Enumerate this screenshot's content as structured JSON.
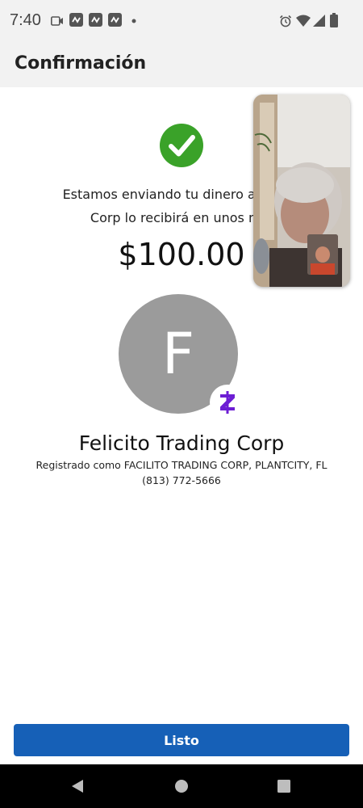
{
  "status_bar": {
    "time": "7:40",
    "left_icons": [
      "video-camera-icon",
      "app-notification-icon",
      "app-notification-icon",
      "app-notification-icon",
      "dot-icon"
    ],
    "right_icons": [
      "alarm-icon",
      "wifi-icon",
      "signal-icon",
      "battery-icon"
    ]
  },
  "header": {
    "title": "Confirmación"
  },
  "confirmation": {
    "message_line1": "Estamos enviando tu dinero ahora. F",
    "message_line2": "Corp lo recibirá en unos min",
    "amount": "$100.00"
  },
  "recipient": {
    "initial": "F",
    "name": "Felicito Trading Corp",
    "registered": "Registrado como FACILITO TRADING CORP, PLANTCITY, FL",
    "phone": "(813) 772-5666"
  },
  "footer": {
    "done_label": "Listo"
  },
  "colors": {
    "success_green": "#3aa229",
    "primary_blue": "#1660b7",
    "zelle_purple": "#6d1ed4",
    "avatar_gray": "#9b9b9b"
  }
}
